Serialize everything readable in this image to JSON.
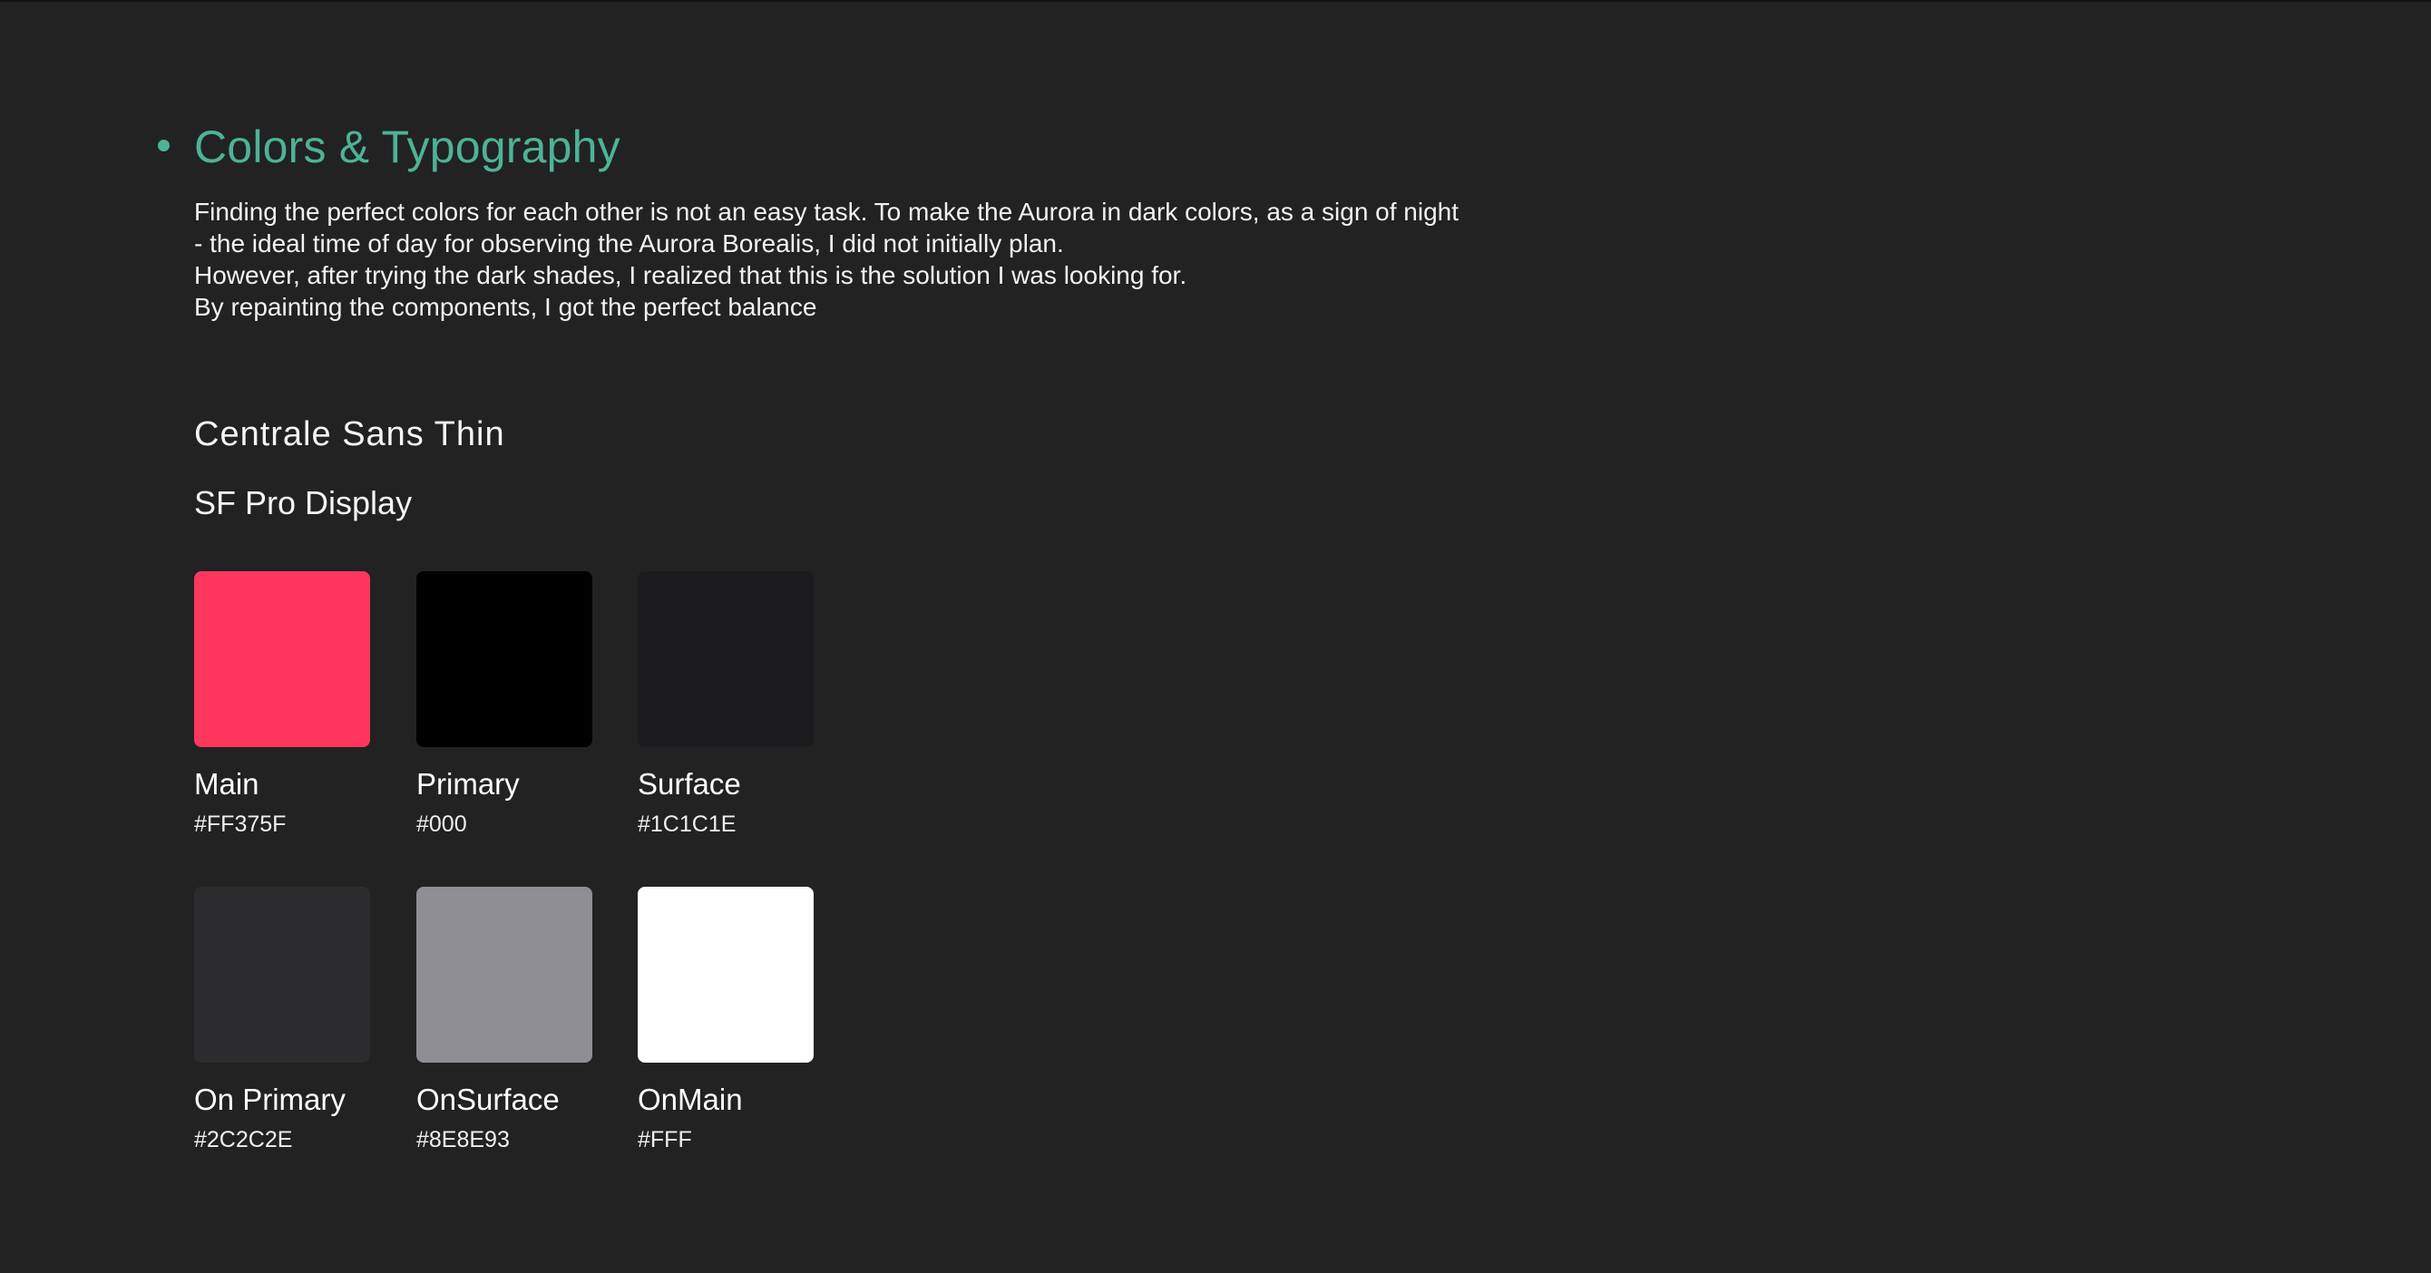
{
  "section": {
    "title": "Colors & Typography",
    "accent_color": "#4DB396",
    "description_lines": [
      "Finding the perfect colors for each other is not an easy task. To make the Aurora in dark colors, as a sign of night",
      "- the ideal time of day for observing the Aurora Borealis, I did not initially plan.",
      "However, after trying the dark shades, I realized that this is the solution I was looking for.",
      "By repainting the components, I got the perfect balance"
    ]
  },
  "fonts": [
    "Centrale Sans Thin",
    "SF Pro Display"
  ],
  "swatches": [
    {
      "name": "Main",
      "hex": "#FF375F",
      "color": "#FF375F"
    },
    {
      "name": "Primary",
      "hex": "#000",
      "color": "#000000"
    },
    {
      "name": "Surface",
      "hex": "#1C1C1E",
      "color": "#1C1C1E"
    },
    {
      "name": "On Primary",
      "hex": "#2C2C2E",
      "color": "#2C2C2E"
    },
    {
      "name": "OnSurface",
      "hex": "#8E8E93",
      "color": "#8E8E93"
    },
    {
      "name": "OnMain",
      "hex": "#FFF",
      "color": "#FFFFFF"
    }
  ]
}
